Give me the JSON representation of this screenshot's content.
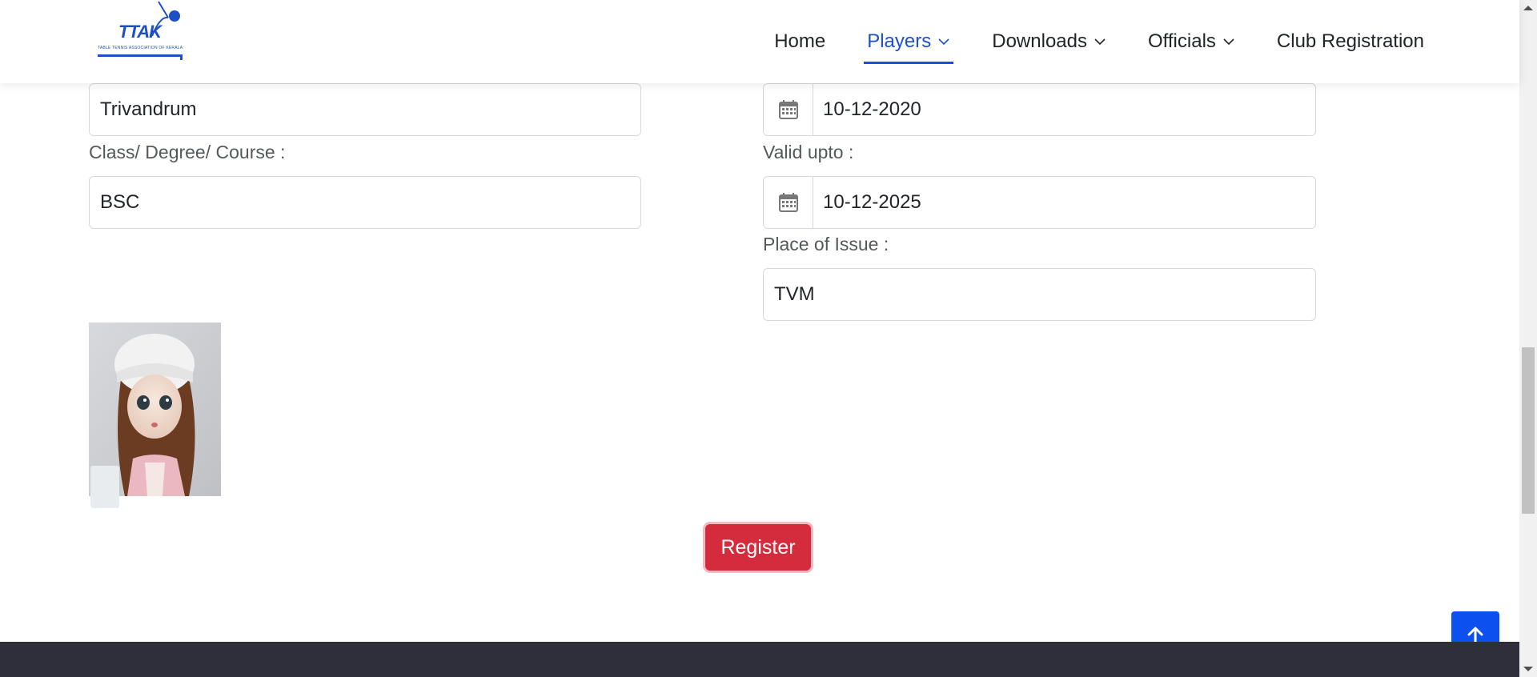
{
  "header": {
    "logo": {
      "text": "TTAK",
      "subtitle": "TABLE TENNIS ASSOCIATION OF KERALA"
    },
    "nav": [
      {
        "label": "Home",
        "active": false,
        "has_dropdown": false
      },
      {
        "label": "Players",
        "active": true,
        "has_dropdown": true
      },
      {
        "label": "Downloads",
        "active": false,
        "has_dropdown": true
      },
      {
        "label": "Officials",
        "active": false,
        "has_dropdown": true
      },
      {
        "label": "Club Registration",
        "active": false,
        "has_dropdown": false
      }
    ]
  },
  "form": {
    "left": {
      "city_value": "Trivandrum",
      "course_label": "Class/ Degree/ Course :",
      "course_value": "BSC"
    },
    "right": {
      "issue_date_value": "10-12-2020",
      "valid_upto_label": "Valid upto :",
      "valid_upto_value": "10-12-2025",
      "place_label": "Place of Issue :",
      "place_value": "TVM"
    },
    "register_label": "Register"
  },
  "colors": {
    "accent": "#1c4fd3",
    "register": "#d42b3d",
    "scroll_top": "#0d50f0",
    "footer": "#2f2f3b"
  },
  "icons": [
    "calendar-icon",
    "chevron-down-icon",
    "arrow-up-icon"
  ]
}
